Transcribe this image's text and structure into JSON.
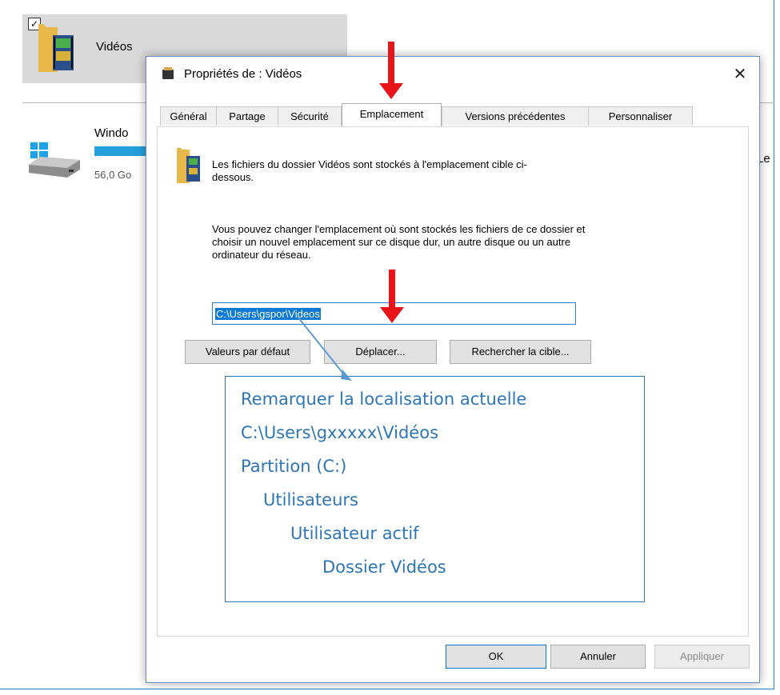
{
  "background": {
    "library_label": "Vidéos",
    "drive_name": "Windo",
    "drive_size": "56,0 Go",
    "right_fragment": "Le"
  },
  "dialog": {
    "title": "Propriétés de : Vidéos",
    "close_glyph": "✕",
    "tabs": [
      {
        "label": "Général"
      },
      {
        "label": "Partage"
      },
      {
        "label": "Sécurité"
      },
      {
        "label": "Emplacement"
      },
      {
        "label": "Versions précédentes"
      },
      {
        "label": "Personnaliser"
      }
    ],
    "info_text": "Les fichiers du dossier Vidéos sont stockés à l'emplacement cible ci-dessous.",
    "change_text": "Vous pouvez changer l'emplacement où sont stockés les fichiers de ce dossier et choisir un nouvel emplacement sur ce disque dur, un autre disque ou un autre ordinateur du réseau.",
    "path_value": "C:\\Users\\gspor\\Videos",
    "buttons": {
      "restore_default": "Valeurs par défaut",
      "move": "Déplacer...",
      "find_target": "Rechercher la cible...",
      "ok": "OK",
      "cancel": "Annuler",
      "apply": "Appliquer"
    }
  },
  "callout": {
    "lines": [
      "Remarquer la localisation actuelle",
      "C:\\Users\\gxxxxx\\Vidéos",
      "Partition (C:)",
      "Utilisateurs",
      "Utilisateur actif",
      "Dossier Vidéos"
    ]
  },
  "colors": {
    "annotation_arrow": "#e8161b",
    "callout_text": "#2e75b6",
    "selection": "#0b7ad6"
  }
}
